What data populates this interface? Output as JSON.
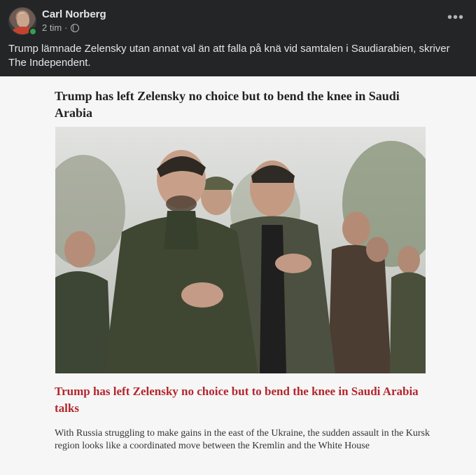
{
  "post": {
    "author": "Carl Norberg",
    "time": "2 tim",
    "separator": "·",
    "more_icon": "more-horizontal-icon",
    "privacy_icon": "globe-icon",
    "text": "Trump lämnade Zelensky utan annat val än att falla på knä vid samtalen i Saudiarabien, skriver The Independent."
  },
  "article": {
    "headline_top": "Trump has left Zelensky no choice but to bend the knee in Saudi Arabia",
    "headline_red": "Trump has left Zelensky no choice but to bend the knee in Saudi Arabia talks",
    "standfirst": "With Russia struggling to make gains in the east of the Ukraine, the sudden assault in the Kursk region looks like a coordinated move between the Kremlin and the White House",
    "headline_color": "#b3262d"
  },
  "colors": {
    "background": "#242526",
    "online": "#31a24c"
  }
}
